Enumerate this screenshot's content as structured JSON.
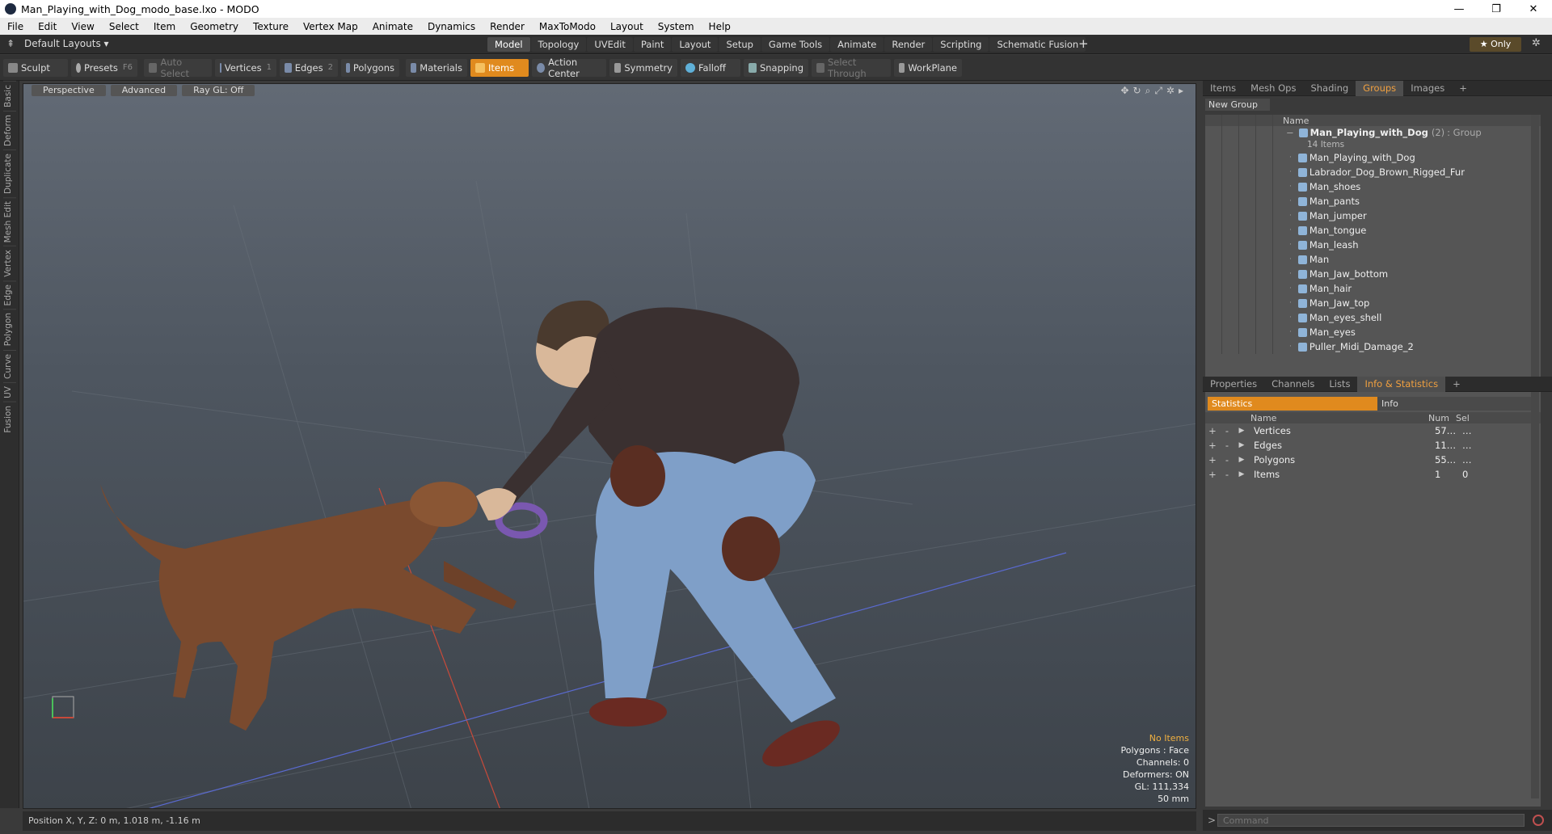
{
  "window": {
    "title": "Man_Playing_with_Dog_modo_base.lxo - MODO"
  },
  "menu": [
    "File",
    "Edit",
    "View",
    "Select",
    "Item",
    "Geometry",
    "Texture",
    "Vertex Map",
    "Animate",
    "Dynamics",
    "Render",
    "MaxToModo",
    "Layout",
    "System",
    "Help"
  ],
  "layout_label": "Default Layouts ▾",
  "mode_tabs": [
    "Model",
    "Topology",
    "UVEdit",
    "Paint",
    "Layout",
    "Setup",
    "Game Tools",
    "Animate",
    "Render",
    "Scripting",
    "Schematic Fusion"
  ],
  "active_mode": "Model",
  "only_label": "★  Only",
  "toolbar": {
    "sculpt": "Sculpt",
    "presets": "Presets",
    "presets_key": "F6",
    "auto_select": "Auto Select",
    "vertices": "Vertices",
    "vertices_n": "1",
    "edges": "Edges",
    "edges_n": "2",
    "polygons": "Polygons",
    "materials": "Materials",
    "items": "Items",
    "action_center": "Action Center",
    "symmetry": "Symmetry",
    "falloff": "Falloff",
    "snapping": "Snapping",
    "select_through": "Select Through",
    "workplane": "WorkPlane"
  },
  "left_tabs": [
    "Basic",
    "Deform",
    "Duplicate",
    "Mesh Edit",
    "Vertex",
    "Edge",
    "Polygon",
    "Curve",
    "UV",
    "Fusion"
  ],
  "viewport": {
    "view": "Perspective",
    "shading": "Advanced",
    "raygl": "Ray GL: Off",
    "info": {
      "items": "No Items",
      "polygons": "Polygons : Face",
      "channels": "Channels: 0",
      "deformers": "Deformers: ON",
      "gl": "GL: 111,334",
      "scale": "50 mm"
    }
  },
  "status": "Position X, Y, Z:  0 m, 1.018 m, -1.16 m",
  "top_panel": {
    "tabs": [
      "Items",
      "Mesh Ops",
      "Shading",
      "Groups",
      "Images"
    ],
    "active": "Groups",
    "new_group": "New Group",
    "name_header": "Name",
    "group": {
      "name": "Man_Playing_with_Dog",
      "count": "(2)",
      "type": ": Group",
      "sub": "14 Items"
    },
    "items": [
      "Man_Playing_with_Dog",
      "Labrador_Dog_Brown_Rigged_Fur",
      "Man_shoes",
      "Man_pants",
      "Man_jumper",
      "Man_tongue",
      "Man_leash",
      "Man",
      "Man_Jaw_bottom",
      "Man_hair",
      "Man_Jaw_top",
      "Man_eyes_shell",
      "Man_eyes",
      "Puller_Midi_Damage_2"
    ]
  },
  "bottom_panel": {
    "tabs": [
      "Properties",
      "Channels",
      "Lists",
      "Info & Statistics"
    ],
    "active": "Info & Statistics",
    "stat_tab": "Statistics",
    "info_tab": "Info",
    "headers": {
      "name": "Name",
      "num": "Num",
      "sel": "Sel"
    },
    "rows": [
      {
        "name": "Vertices",
        "num": "57…",
        "sel": "…"
      },
      {
        "name": "Edges",
        "num": "11…",
        "sel": "…"
      },
      {
        "name": "Polygons",
        "num": "55…",
        "sel": "…"
      },
      {
        "name": "Items",
        "num": "1",
        "sel": "0"
      }
    ]
  },
  "command_placeholder": "Command",
  "colors": {
    "accent": "#e08a1e",
    "dog": "#7a4a2e",
    "jumper": "#3a3030",
    "jeans": "#7f9fc8"
  }
}
